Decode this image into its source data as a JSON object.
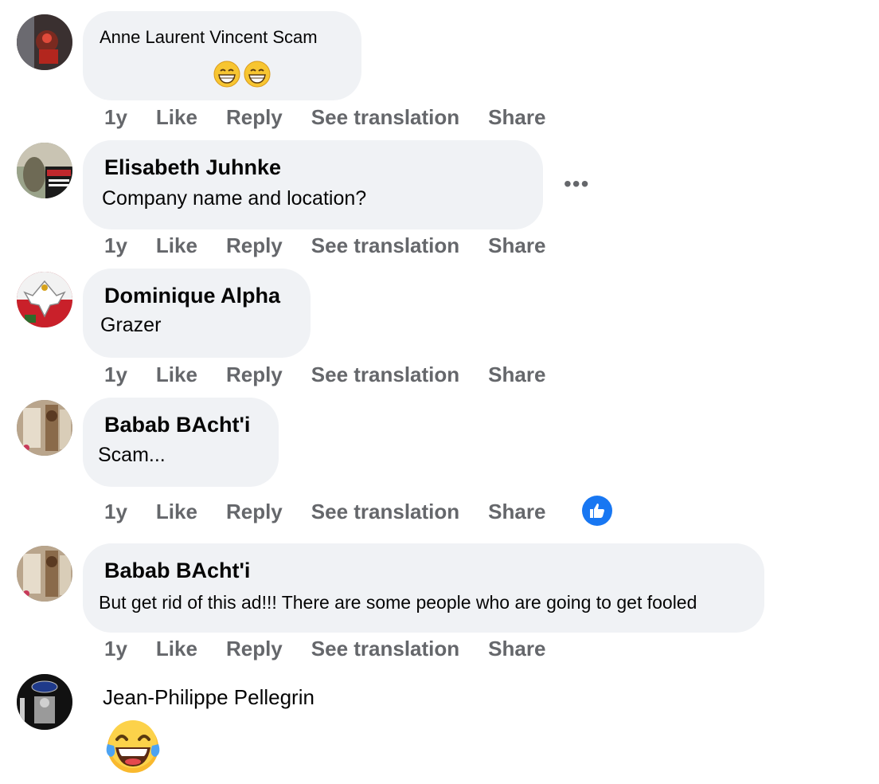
{
  "comments": [
    {
      "name": "Anne Laurent Vincent Scam",
      "text": "",
      "emojis": "grin-grin",
      "age": "1y",
      "like": "Like",
      "reply": "Reply",
      "translate": "See translation",
      "share": "Share"
    },
    {
      "name": "Elisabeth Juhnke",
      "text": "Company name and location?",
      "age": "1y",
      "like": "Like",
      "reply": "Reply",
      "translate": "See translation",
      "share": "Share",
      "more": "•••"
    },
    {
      "name": "Dominique Alpha",
      "text": "Grazer",
      "age": "1y",
      "like": "Like",
      "reply": "Reply",
      "translate": "See translation",
      "share": "Share"
    },
    {
      "name": "Babab BAcht'i",
      "text": "Scam...",
      "age": "1y",
      "like": "Like",
      "reply": "Reply",
      "translate": "See translation",
      "share": "Share",
      "reaction": "like-icon"
    },
    {
      "name": "Babab BAcht'i",
      "text": "But get rid of this ad!!! There are some people who are going to get fooled",
      "age": "1y",
      "like": "Like",
      "reply": "Reply",
      "translate": "See translation",
      "share": "Share"
    },
    {
      "name": "Jean-Philippe Pellegrin",
      "emoji": "laughing-tears"
    }
  ],
  "colors": {
    "bubble": "#f0f2f5",
    "meta": "#65676b",
    "like_blue": "#1877f2"
  }
}
